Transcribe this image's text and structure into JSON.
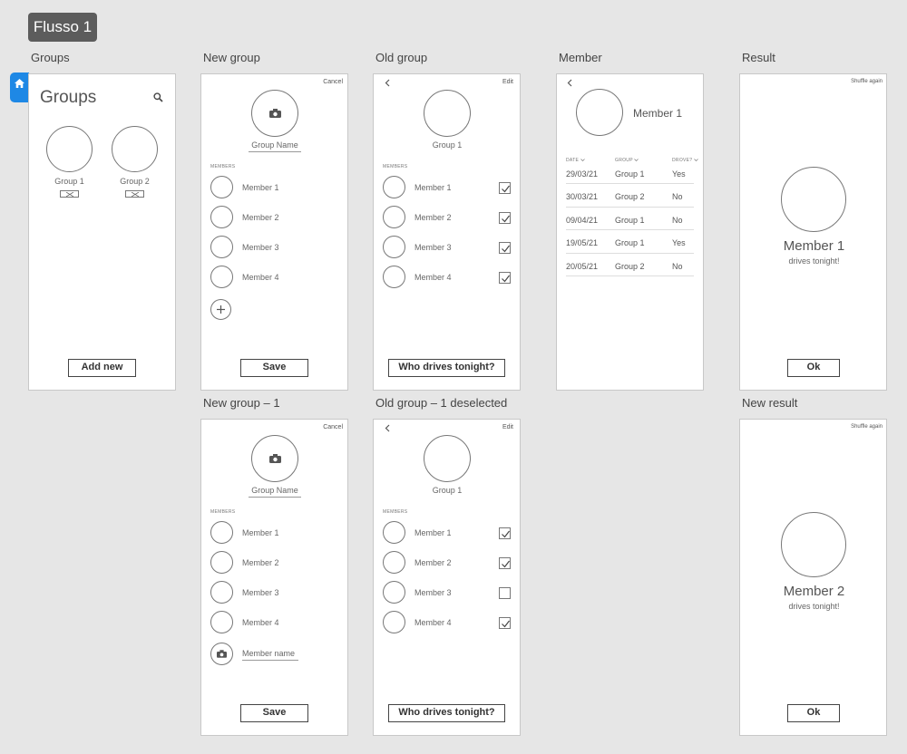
{
  "flow_title": "Flusso 1",
  "icons": {
    "home": "home-icon",
    "search": "search-icon",
    "camera": "camera-icon",
    "back": "chevron-left-icon",
    "plus": "plus-icon",
    "check": "check-icon",
    "dropdown": "chevron-down-icon",
    "edit": "edit-icon"
  },
  "colors": {
    "background": "#e6e6e6",
    "accent": "#1e88e5",
    "badge": "#5c5c5c"
  },
  "frames": {
    "groups": {
      "label": "Groups",
      "title": "Groups",
      "group1": "Group 1",
      "group2": "Group 2",
      "add_new": "Add new"
    },
    "new_group": {
      "label": "New group",
      "cancel": "Cancel",
      "group_name_placeholder": "Group Name",
      "members_header": "MEMBERS",
      "members": [
        "Member 1",
        "Member 2",
        "Member 3",
        "Member 4"
      ],
      "save": "Save"
    },
    "old_group": {
      "label": "Old group",
      "edit": "Edit",
      "group_name": "Group 1",
      "members_header": "MEMBERS",
      "members": [
        "Member 1",
        "Member 2",
        "Member 3",
        "Member 4"
      ],
      "checked": [
        true,
        true,
        true,
        true
      ],
      "action": "Who drives tonight?"
    },
    "member": {
      "label": "Member",
      "name": "Member 1",
      "columns": [
        "DATE",
        "GROUP",
        "DROVE?"
      ],
      "rows": [
        [
          "29/03/21",
          "Group 1",
          "Yes"
        ],
        [
          "30/03/21",
          "Group 2",
          "No"
        ],
        [
          "09/04/21",
          "Group 1",
          "No"
        ],
        [
          "19/05/21",
          "Group 1",
          "Yes"
        ],
        [
          "20/05/21",
          "Group 2",
          "No"
        ]
      ]
    },
    "result": {
      "label": "Result",
      "shuffle": "Shuffle again",
      "name": "Member 1",
      "subtitle": "drives tonight!",
      "ok": "Ok"
    },
    "new_group_1": {
      "label": "New group – 1",
      "cancel": "Cancel",
      "group_name_placeholder": "Group Name",
      "members_header": "MEMBERS",
      "members": [
        "Member 1",
        "Member 2",
        "Member 3",
        "Member 4"
      ],
      "member_name_placeholder": "Member name",
      "save": "Save"
    },
    "old_group_deselected": {
      "label": "Old group – 1 deselected",
      "edit": "Edit",
      "group_name": "Group 1",
      "members_header": "MEMBERS",
      "members": [
        "Member 1",
        "Member 2",
        "Member 3",
        "Member 4"
      ],
      "checked": [
        true,
        true,
        false,
        true
      ],
      "action": "Who drives tonight?"
    },
    "new_result": {
      "label": "New result",
      "shuffle": "Shuffle again",
      "name": "Member 2",
      "subtitle": "drives tonight!",
      "ok": "Ok"
    }
  }
}
